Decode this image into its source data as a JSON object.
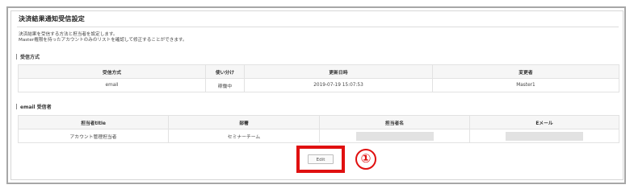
{
  "page": {
    "title": "決済結果通知受信設定",
    "description_lines": [
      "決済結果を受信する方法と担当者を設定します。",
      "Master権限を持ったアカウントのみのリストを確認して修正することができます。"
    ]
  },
  "receive_method": {
    "section_label": "受信方式",
    "headers": [
      "受信方式",
      "使い分け",
      "更新日時",
      "変更者"
    ],
    "rows": [
      [
        "email",
        "稼働中",
        "2019-07-19 15:07:53",
        "Master1"
      ]
    ]
  },
  "email_recipients": {
    "section_label": "email 受信者",
    "headers": [
      "担当者title",
      "部署",
      "担当者名",
      "Eメール"
    ],
    "rows": [
      [
        "アカウント管理担当者",
        "セミナーチーム",
        "",
        ""
      ]
    ]
  },
  "actions": {
    "edit_label": "Edit",
    "step_marker": "①"
  },
  "colors": {
    "highlight": "#e01010"
  }
}
